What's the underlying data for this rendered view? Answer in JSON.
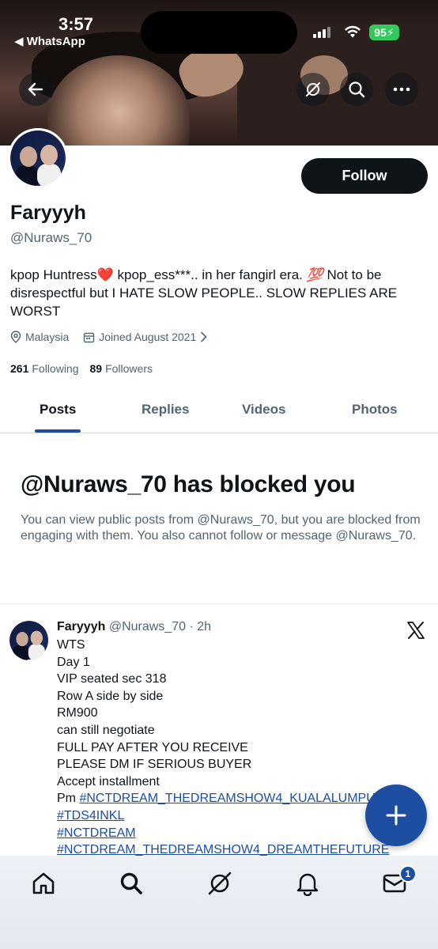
{
  "status_bar": {
    "time": "3:57",
    "back_app": "◀ WhatsApp",
    "battery": "95"
  },
  "header": {
    "back_icon": "arrow-left-icon",
    "actions": [
      "grok-icon",
      "search-icon",
      "more-icon"
    ]
  },
  "profile": {
    "name": "Faryyyh",
    "handle": "@Nuraws_70",
    "follow_label": "Follow",
    "bio_part1": "kpop Huntress",
    "bio_heart": "❤️",
    "bio_part2": " kpop_ess***.. in her fangirl era. ",
    "bio_hundred": "💯",
    "bio_part3": " Not to be disrespectful but I HATE SLOW PEOPLE.. SLOW REPLIES ARE WORST",
    "location": "Malaysia",
    "joined": "Joined August 2021",
    "following_count": "261",
    "following_label": "Following",
    "followers_count": "89",
    "followers_label": "Followers"
  },
  "tabs": [
    {
      "label": "Posts",
      "active": true
    },
    {
      "label": "Replies",
      "active": false
    },
    {
      "label": "Videos",
      "active": false
    },
    {
      "label": "Photos",
      "active": false
    }
  ],
  "blocked": {
    "title": "@Nuraws_70 has blocked you",
    "message": "You can view public posts from @Nuraws_70, but you are blocked from engaging with them. You also cannot follow or message @Nuraws_70."
  },
  "post": {
    "name": "Faryyyh",
    "handle_time": "@Nuraws_70 · 2h",
    "lines": [
      "WTS",
      "Day 1",
      "VIP seated sec 318",
      "Row A side by side",
      "RM900",
      "can still negotiate",
      "FULL PAY AFTER YOU RECEIVE",
      "PLEASE DM IF SERIOUS BUYER",
      "Accept installment"
    ],
    "pm_prefix": "Pm  ",
    "hashtags": [
      "#NCTDREAM_THEDREAMSHOW4_KUALALUMPUR",
      "#TDS4INKL",
      "#NCTDREAM",
      "#NCTDREAM_THEDREAMSHOW4_DREAMTHEFUTURE"
    ]
  },
  "bottom_nav": {
    "items": [
      "home-icon",
      "search-icon",
      "grok-icon",
      "notifications-icon",
      "messages-icon"
    ],
    "messages_badge": "1"
  },
  "colors": {
    "accent": "#1d4ea1",
    "text": "#0f1419",
    "muted": "#536471"
  }
}
